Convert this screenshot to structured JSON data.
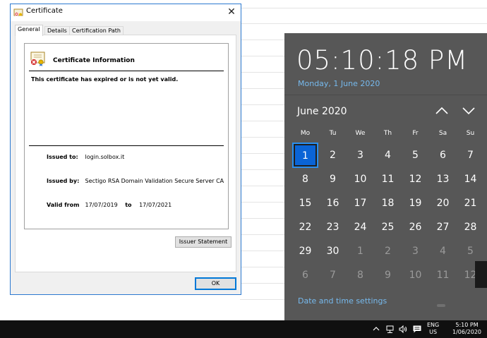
{
  "dialog": {
    "title": "Certificate",
    "close_glyph": "✕",
    "tabs": [
      {
        "label": "General",
        "active": true
      },
      {
        "label": "Details",
        "active": false
      },
      {
        "label": "Certification Path",
        "active": false
      }
    ],
    "heading": "Certificate Information",
    "warning": "This certificate has expired or is not yet valid.",
    "issued_to_label": "Issued to:",
    "issued_to_value": "login.solbox.it",
    "issued_by_label": "Issued by:",
    "issued_by_value": "Sectigo RSA Domain Validation Secure Server CA",
    "valid_from_label": "Valid from",
    "valid_from_value": "17/07/2019",
    "valid_to_label": "to",
    "valid_to_value": "17/07/2021",
    "issuer_button": "Issuer Statement",
    "ok_button": "OK"
  },
  "flyout": {
    "time": "05:10:18 PM",
    "date": "Monday, 1 June 2020",
    "month": "June 2020",
    "weekdays": [
      "Mo",
      "Tu",
      "We",
      "Th",
      "Fr",
      "Sa",
      "Su"
    ],
    "weeks": [
      [
        {
          "d": "1",
          "out": false,
          "today": true
        },
        {
          "d": "2"
        },
        {
          "d": "3"
        },
        {
          "d": "4"
        },
        {
          "d": "5"
        },
        {
          "d": "6"
        },
        {
          "d": "7"
        }
      ],
      [
        {
          "d": "8"
        },
        {
          "d": "9"
        },
        {
          "d": "10"
        },
        {
          "d": "11"
        },
        {
          "d": "12"
        },
        {
          "d": "13"
        },
        {
          "d": "14"
        }
      ],
      [
        {
          "d": "15"
        },
        {
          "d": "16"
        },
        {
          "d": "17"
        },
        {
          "d": "18"
        },
        {
          "d": "19"
        },
        {
          "d": "20"
        },
        {
          "d": "21"
        }
      ],
      [
        {
          "d": "22"
        },
        {
          "d": "23"
        },
        {
          "d": "24"
        },
        {
          "d": "25"
        },
        {
          "d": "26"
        },
        {
          "d": "27"
        },
        {
          "d": "28"
        }
      ],
      [
        {
          "d": "29"
        },
        {
          "d": "30"
        },
        {
          "d": "1",
          "out": true
        },
        {
          "d": "2",
          "out": true
        },
        {
          "d": "3",
          "out": true
        },
        {
          "d": "4",
          "out": true
        },
        {
          "d": "5",
          "out": true
        }
      ],
      [
        {
          "d": "6",
          "out": true
        },
        {
          "d": "7",
          "out": true
        },
        {
          "d": "8",
          "out": true
        },
        {
          "d": "9",
          "out": true
        },
        {
          "d": "10",
          "out": true
        },
        {
          "d": "11",
          "out": true
        },
        {
          "d": "12",
          "out": true
        }
      ]
    ],
    "settings_link": "Date and time settings",
    "accent_color": "#0a64d6",
    "link_color": "#76b9ed"
  },
  "taskbar": {
    "language_line1": "ENG",
    "language_line2": "US",
    "time": "5:10 PM",
    "date": "1/06/2020",
    "tray_icons": [
      "chevron-up-icon",
      "network-icon",
      "volume-icon",
      "notification-icon"
    ]
  }
}
